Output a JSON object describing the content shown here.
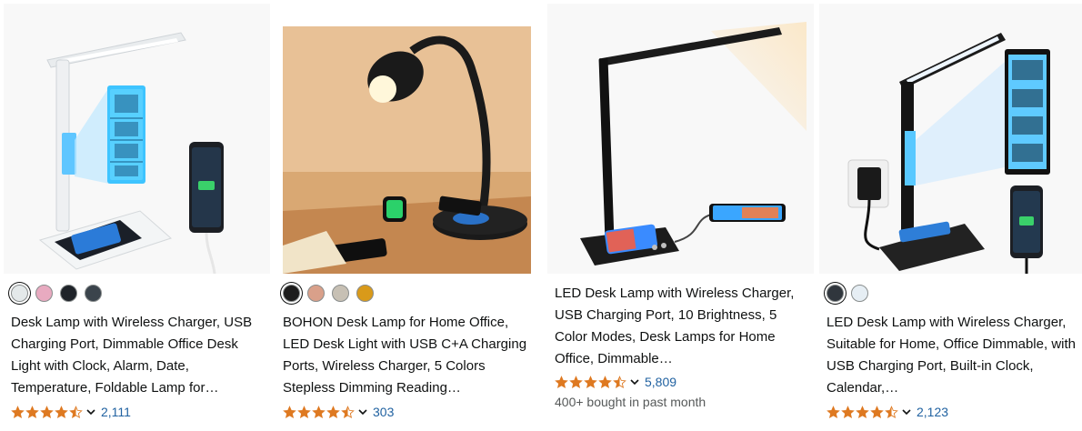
{
  "products": [
    {
      "image_alt": "White LED desk lamp with LCD clock display and wireless charging base with phone",
      "swatches": [
        "#e4e9ea",
        "#e8aac0",
        "#1f2329",
        "#3b444c"
      ],
      "selected_swatch": 0,
      "title": "Desk Lamp with Wireless Charger, USB Charging Port, Dimmable Office Desk Light with Clock, Alarm, Date, Temperature, Foldable Lamp for…",
      "rating": 4.5,
      "review_count": "2,111",
      "bought": ""
    },
    {
      "image_alt": "Black gooseneck desk lamp on wooden desk with wireless charger and smartwatch",
      "swatches": [
        "#1c1c1c",
        "#d9a08a",
        "#c7c0b4",
        "#d99a1a"
      ],
      "selected_swatch": 0,
      "title": "BOHON Desk Lamp for Home Office, LED Desk Light with USB C+A Charging Ports, Wireless Charger, 5 Colors Stepless Dimming Reading…",
      "rating": 4.5,
      "review_count": "303",
      "bought": ""
    },
    {
      "image_alt": "Black LED desk lamp with wireless charging base and phone plugged in via USB",
      "swatches": [],
      "selected_swatch": -1,
      "title": "LED Desk Lamp with Wireless Charger, USB Charging Port, 10 Brightness, 5 Color Modes, Desk Lamps for Home Office, Dimmable…",
      "rating": 4.5,
      "review_count": "5,809",
      "bought": "400+ bought in past month"
    },
    {
      "image_alt": "Black LED desk lamp with blue LCD clock display, wall adapter and wireless charging base",
      "swatches": [
        "#30363d",
        "#e6eef4"
      ],
      "selected_swatch": 0,
      "title": "LED Desk Lamp with Wireless Charger, Suitable for Home, Office Dimmable, with USB Charging Port, Built-in Clock, Calendar,…",
      "rating": 4.5,
      "review_count": "2,123",
      "bought": ""
    }
  ],
  "colors": {
    "star": "#de7921",
    "link": "#2162a1",
    "muted": "#565959"
  },
  "icons": {
    "star": "star-icon",
    "half_star": "half-star-icon",
    "chevron": "chevron-down-icon"
  }
}
